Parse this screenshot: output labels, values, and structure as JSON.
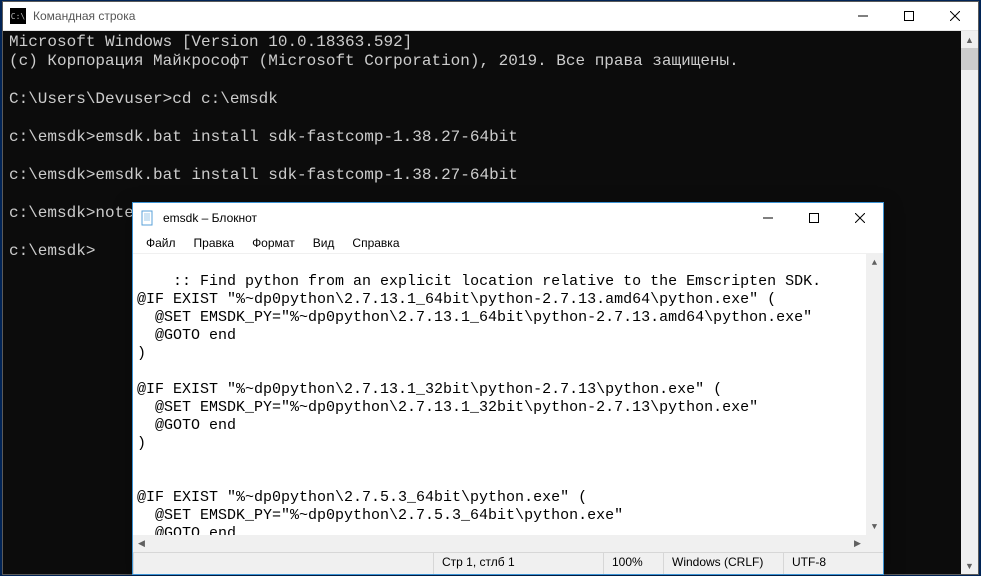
{
  "cmd": {
    "title": "Командная строка",
    "icon_glyph": "C:\\",
    "body": "Microsoft Windows [Version 10.0.18363.592]\n(c) Корпорация Майкрософт (Microsoft Corporation), 2019. Все права защищены.\n\nC:\\Users\\Devuser>cd c:\\emsdk\n\nc:\\emsdk>emsdk.bat install sdk-fastcomp-1.38.27-64bit\n\nc:\\emsdk>emsdk.bat install sdk-fastcomp-1.38.27-64bit\n\nc:\\emsdk>notepad emsdk.bat\n\nc:\\emsdk>"
  },
  "notepad": {
    "title": "emsdk – Блокнот",
    "menu": {
      "file": "Файл",
      "edit": "Правка",
      "format": "Формат",
      "view": "Вид",
      "help": "Справка"
    },
    "body": ":: Find python from an explicit location relative to the Emscripten SDK.\n@IF EXIST \"%~dp0python\\2.7.13.1_64bit\\python-2.7.13.amd64\\python.exe\" (\n  @SET EMSDK_PY=\"%~dp0python\\2.7.13.1_64bit\\python-2.7.13.amd64\\python.exe\"\n  @GOTO end\n)\n\n@IF EXIST \"%~dp0python\\2.7.13.1_32bit\\python-2.7.13\\python.exe\" (\n  @SET EMSDK_PY=\"%~dp0python\\2.7.13.1_32bit\\python-2.7.13\\python.exe\"\n  @GOTO end\n)\n\n\n@IF EXIST \"%~dp0python\\2.7.5.3_64bit\\python.exe\" (\n  @SET EMSDK_PY=\"%~dp0python\\2.7.5.3_64bit\\python.exe\"\n  @GOTO end\n)",
    "status": {
      "cursor": "Стр 1, стлб 1",
      "zoom": "100%",
      "eol": "Windows (CRLF)",
      "encoding": "UTF-8"
    }
  }
}
